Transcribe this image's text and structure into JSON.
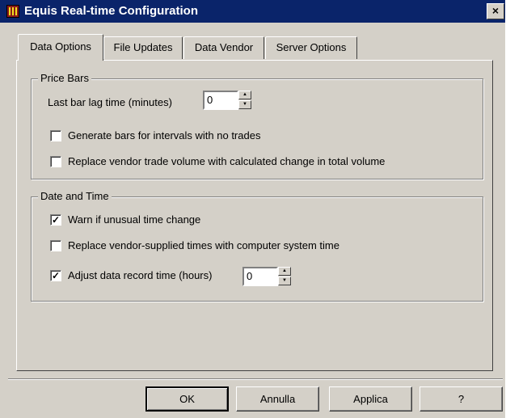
{
  "window": {
    "title": "Equis Real-time Configuration",
    "close_glyph": "×"
  },
  "tabs": [
    {
      "label": "Data Options",
      "active": true
    },
    {
      "label": "File Updates",
      "active": false
    },
    {
      "label": "Data Vendor",
      "active": false
    },
    {
      "label": "Server Options",
      "active": false
    }
  ],
  "price_bars": {
    "title": "Price Bars",
    "lag_label": "Last bar lag time (minutes)",
    "lag_value": "0",
    "generate_bars": {
      "label": "Generate bars for intervals with no trades",
      "checked": false
    },
    "replace_volume": {
      "label": "Replace vendor trade volume with calculated change in total volume",
      "checked": false
    }
  },
  "date_time": {
    "title": "Date and Time",
    "warn_unusual": {
      "label": "Warn if unusual time change",
      "checked": true
    },
    "replace_times": {
      "label": "Replace vendor-supplied times with computer system time",
      "checked": false
    },
    "adjust_time": {
      "label": "Adjust data record time (hours)",
      "checked": true,
      "value": "0"
    }
  },
  "buttons": {
    "ok": "OK",
    "cancel": "Annulla",
    "apply": "Applica",
    "help": "?"
  },
  "colors": {
    "face": "#d4d0c8",
    "titlebar": "#0a246a"
  }
}
